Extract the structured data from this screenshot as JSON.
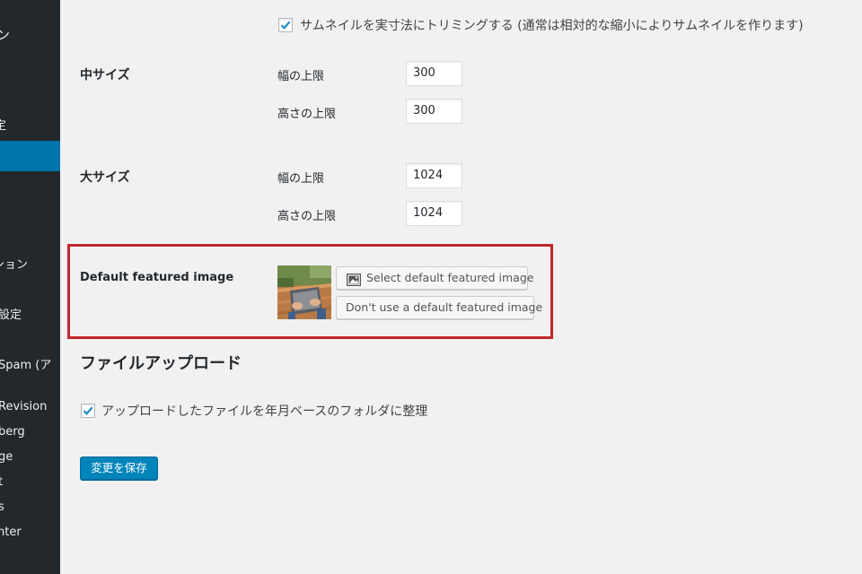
{
  "sidebar": {
    "items": [
      {
        "label": "ン"
      },
      {
        "label": "定"
      },
      {
        "label": ""
      },
      {
        "label": "ション"
      },
      {
        "label": "設定"
      },
      {
        "label": "Spam (ア"
      },
      {
        "label": "Revision"
      },
      {
        "label": "berg"
      },
      {
        "label": "ge"
      },
      {
        "label": "t"
      },
      {
        "label": "s"
      },
      {
        "label": "nter"
      }
    ]
  },
  "media": {
    "crop_checkbox_label": "サムネイルを実寸法にトリミングする (通常は相対的な縮小によりサムネイルを作ります)",
    "crop_checked": true,
    "medium": {
      "title": "中サイズ",
      "width_label": "幅の上限",
      "width_value": "300",
      "height_label": "高さの上限",
      "height_value": "300"
    },
    "large": {
      "title": "大サイズ",
      "width_label": "幅の上限",
      "width_value": "1024",
      "height_label": "高さの上限",
      "height_value": "1024"
    },
    "default_featured": {
      "title": "Default featured image",
      "select_button": "Select default featured image",
      "remove_button": "Don't use a default featured image"
    }
  },
  "uploads": {
    "title": "ファイルアップロード",
    "organize_checkbox_label": "アップロードしたファイルを年月ベースのフォルダに整理",
    "organize_checked": true
  },
  "save_button": "変更を保存",
  "colors": {
    "sidebar_bg": "#23282d",
    "sidebar_active": "#0073aa",
    "primary_button": "#0085ba",
    "highlight_border": "#c1272d",
    "page_bg": "#f1f1f1"
  }
}
